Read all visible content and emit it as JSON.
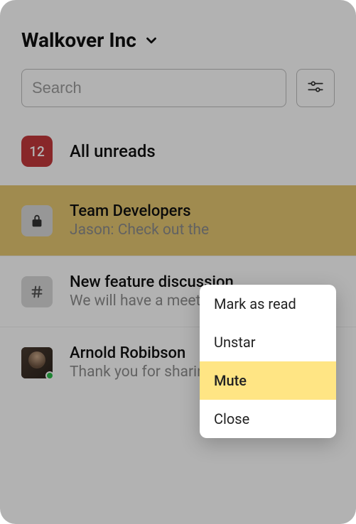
{
  "workspace": {
    "name": "Walkover Inc"
  },
  "search": {
    "placeholder": "Search"
  },
  "allUnreads": {
    "count": "12",
    "label": "All unreads"
  },
  "channels": [
    {
      "title": "Team Developers",
      "preview": "Jason: Check out the"
    },
    {
      "title": "New feature discussion",
      "preview": "We will have a meeting"
    },
    {
      "title": "Arnold Robibson",
      "preview": "Thank you for sharin...."
    }
  ],
  "contextMenu": {
    "markRead": "Mark as read",
    "unstar": "Unstar",
    "mute": "Mute",
    "close": "Close"
  }
}
